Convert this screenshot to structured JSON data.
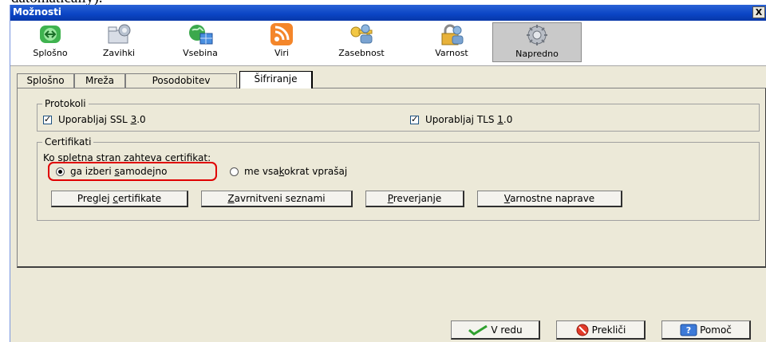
{
  "caption_fragment": "datomatically).",
  "window": {
    "title": "Možnosti",
    "close_glyph": "X"
  },
  "toolbar": [
    {
      "label": "Splošno",
      "icon": "general-icon"
    },
    {
      "label": "Zavihki",
      "icon": "tabs-icon"
    },
    {
      "label": "Vsebina",
      "icon": "content-icon"
    },
    {
      "label": "Viri",
      "icon": "feeds-icon"
    },
    {
      "label": "Zasebnost",
      "icon": "privacy-icon"
    },
    {
      "label": "Varnost",
      "icon": "security-icon"
    },
    {
      "label": "Napredno",
      "icon": "advanced-icon",
      "active": true
    }
  ],
  "tabs": [
    "Splošno",
    "Mreža",
    "Posodobitev",
    "Šifriranje"
  ],
  "protocols": {
    "legend": "Protokoli",
    "ssl": {
      "pre": "Uporabljaj SSL ",
      "key": "3",
      "post": ".0",
      "checked": true
    },
    "tls": {
      "pre": "Uporabljaj TLS ",
      "key": "1",
      "post": ".0",
      "checked": true
    }
  },
  "certificates": {
    "legend": "Certifikati",
    "prompt": "Ko spletna stran zahteva certifikat:",
    "option_auto": {
      "pre": "ga izberi ",
      "key": "s",
      "post": "amodejno",
      "selected": true
    },
    "option_ask": {
      "pre": "me vsa",
      "key": "k",
      "post": "okrat vprašaj",
      "selected": false
    },
    "buttons": [
      {
        "pre": "Preglej ",
        "key": "c",
        "post": "ertifikate"
      },
      {
        "pre": "",
        "key": "Z",
        "post": "avrnitveni seznami"
      },
      {
        "pre": "",
        "key": "P",
        "post": "reverjanje"
      },
      {
        "pre": "",
        "key": "V",
        "post": "arnostne naprave"
      }
    ]
  },
  "dialog": {
    "ok": "V redu",
    "cancel": "Prekliči",
    "help": "Pomoč"
  },
  "colors": {
    "title_bar": "#0a44c4",
    "face": "#ece9d8",
    "highlight": "#e00000"
  }
}
